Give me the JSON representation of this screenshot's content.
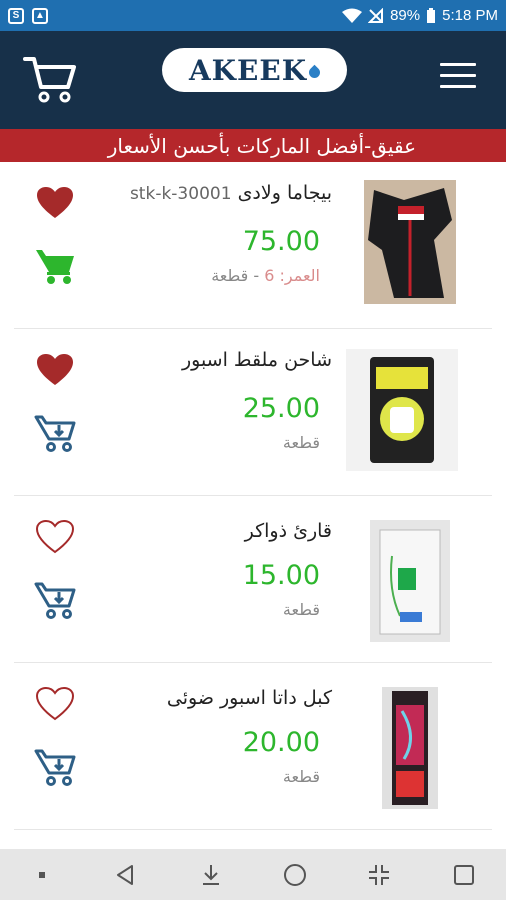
{
  "status": {
    "battery": "89%",
    "time": "5:18 PM",
    "left_icons": [
      "skype-icon",
      "image-icon"
    ],
    "right_icons": [
      "wifi-icon",
      "no-signal-icon",
      "battery-icon"
    ]
  },
  "header": {
    "logo_text": "AKEEK",
    "cart_icon": "cart-icon",
    "menu_icon": "hamburger-menu-icon"
  },
  "banner": {
    "text": "عقيق-أفضل الماركات بأحسن الأسعار"
  },
  "colors": {
    "header_bg": "#173049",
    "banner_bg": "#b5272b",
    "price_green": "#2db62d",
    "heart_red": "#a52a2a",
    "cart_blue": "#2e5f86",
    "cart_green": "#2db62d"
  },
  "products": [
    {
      "code": "stk-k-30001",
      "name": "بيجاما ولادى",
      "price": "75.00",
      "age_label": "العمر: 6",
      "unit": "قطعة",
      "favorited": true,
      "in_cart": true
    },
    {
      "code": "",
      "name": "شاحن ملقط اسبور",
      "price": "25.00",
      "age_label": "",
      "unit": "قطعة",
      "favorited": true,
      "in_cart": false
    },
    {
      "code": "",
      "name": "قارئ ذواكر",
      "price": "15.00",
      "age_label": "",
      "unit": "قطعة",
      "favorited": false,
      "in_cart": false
    },
    {
      "code": "",
      "name": "كبل داتا اسبور ضوئى",
      "price": "20.00",
      "age_label": "",
      "unit": "قطعة",
      "favorited": false,
      "in_cart": false
    }
  ],
  "navbar": {
    "icons": [
      "dot-icon",
      "back-icon",
      "download-icon",
      "home-icon",
      "collapse-icon",
      "recents-icon"
    ]
  }
}
